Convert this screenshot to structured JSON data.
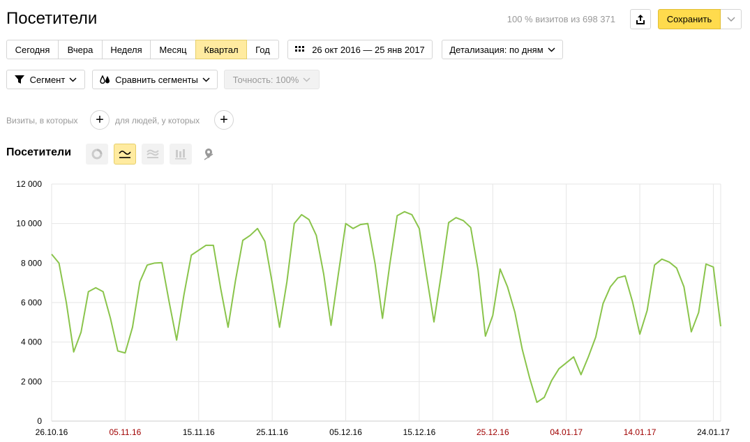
{
  "header": {
    "title": "Посетители",
    "visits_info": "100 % визитов из 698 371",
    "save_label": "Сохранить"
  },
  "periods": [
    {
      "label": "Сегодня",
      "active": false
    },
    {
      "label": "Вчера",
      "active": false
    },
    {
      "label": "Неделя",
      "active": false
    },
    {
      "label": "Месяц",
      "active": false
    },
    {
      "label": "Квартал",
      "active": true
    },
    {
      "label": "Год",
      "active": false
    }
  ],
  "date_range": "26 окт 2016 — 25 янв 2017",
  "detail": "Детализация: по дням",
  "segment_label": "Сегмент",
  "compare_label": "Сравнить сегменты",
  "accuracy_label": "Точность: 100%",
  "conditions": {
    "visits_label": "Визиты, в которых",
    "people_label": "для людей, у которых"
  },
  "chart_section": {
    "title": "Посетители",
    "chart_types": [
      "pie-chart-icon",
      "line-chart-icon",
      "area-chart-icon",
      "bar-chart-icon",
      "map-icon"
    ],
    "active_type": "line-chart-icon"
  },
  "colors": {
    "accent": "#ffdb4d",
    "line": "#8ac44b",
    "holiday_label": "#a00000"
  },
  "chart_data": {
    "type": "line",
    "ylim": [
      0,
      12000
    ],
    "yticks": [
      0,
      2000,
      4000,
      6000,
      8000,
      10000,
      12000
    ],
    "ytick_labels": [
      "0",
      "2 000",
      "4 000",
      "6 000",
      "8 000",
      "10 000",
      "12 000"
    ],
    "x_start": "2016-10-26",
    "xtick_labels": [
      {
        "label": "26.10.16",
        "holiday": false
      },
      {
        "label": "05.11.16",
        "holiday": true
      },
      {
        "label": "15.11.16",
        "holiday": false
      },
      {
        "label": "25.11.16",
        "holiday": false
      },
      {
        "label": "05.12.16",
        "holiday": false
      },
      {
        "label": "15.12.16",
        "holiday": false
      },
      {
        "label": "25.12.16",
        "holiday": true
      },
      {
        "label": "04.01.17",
        "holiday": true
      },
      {
        "label": "14.01.17",
        "holiday": true
      },
      {
        "label": "24.01.17",
        "holiday": false
      }
    ],
    "values": [
      8450,
      8000,
      6000,
      3500,
      4500,
      6550,
      6750,
      6550,
      5200,
      3550,
      3450,
      4750,
      7050,
      7900,
      8000,
      8020,
      6000,
      4100,
      6400,
      8400,
      8650,
      8900,
      8900,
      6700,
      4750,
      7100,
      9150,
      9400,
      9750,
      9100,
      7000,
      4750,
      7050,
      10000,
      10450,
      10200,
      9400,
      7450,
      4850,
      7450,
      10000,
      9750,
      9950,
      10000,
      7950,
      5200,
      7950,
      10400,
      10600,
      10450,
      9750,
      7350,
      5020,
      7450,
      10050,
      10300,
      10150,
      9800,
      7650,
      4300,
      5350,
      7700,
      6800,
      5520,
      3650,
      2200,
      950,
      1200,
      2050,
      2650,
      2950,
      3250,
      2350,
      3250,
      4250,
      5950,
      6800,
      7250,
      7350,
      6050,
      4400,
      5600,
      7900,
      8200,
      8050,
      7750,
      6800,
      4520,
      5500,
      7950,
      7800,
      4800
    ]
  }
}
